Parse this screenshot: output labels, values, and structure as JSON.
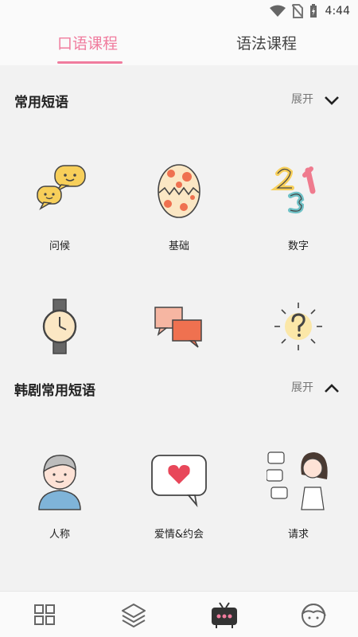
{
  "status_bar": {
    "time": "4:44",
    "icons": [
      "wifi-icon",
      "no-sim-icon",
      "battery-charging-icon"
    ]
  },
  "tabs": [
    {
      "label": "口语课程",
      "active": true
    },
    {
      "label": "语法课程",
      "active": false
    }
  ],
  "sections": [
    {
      "title": "常用短语",
      "toggle_label": "展开",
      "chevron": "chevron-down-icon",
      "items": [
        {
          "label": "问候",
          "icon": "speech-bubbles-icon"
        },
        {
          "label": "基础",
          "icon": "cracked-egg-icon"
        },
        {
          "label": "数字",
          "icon": "numbers-icon"
        },
        {
          "label": "",
          "icon": "wristwatch-icon"
        },
        {
          "label": "",
          "icon": "chat-squares-icon"
        },
        {
          "label": "",
          "icon": "question-mark-icon"
        }
      ]
    },
    {
      "title": "韩剧常用短语",
      "toggle_label": "展开",
      "chevron": "chevron-up-icon",
      "items": [
        {
          "label": "人称",
          "icon": "person-icon"
        },
        {
          "label": "爱情&约会",
          "icon": "heart-message-icon"
        },
        {
          "label": "请求",
          "icon": "girl-talking-icon"
        }
      ]
    }
  ],
  "bottom_nav": [
    {
      "icon": "grid-icon"
    },
    {
      "icon": "layers-icon"
    },
    {
      "icon": "tv-icon",
      "active": true
    },
    {
      "icon": "profile-icon"
    }
  ],
  "colors": {
    "accent": "#f07c9e",
    "background": "#f2f2f2",
    "bar": "#fafafa"
  }
}
